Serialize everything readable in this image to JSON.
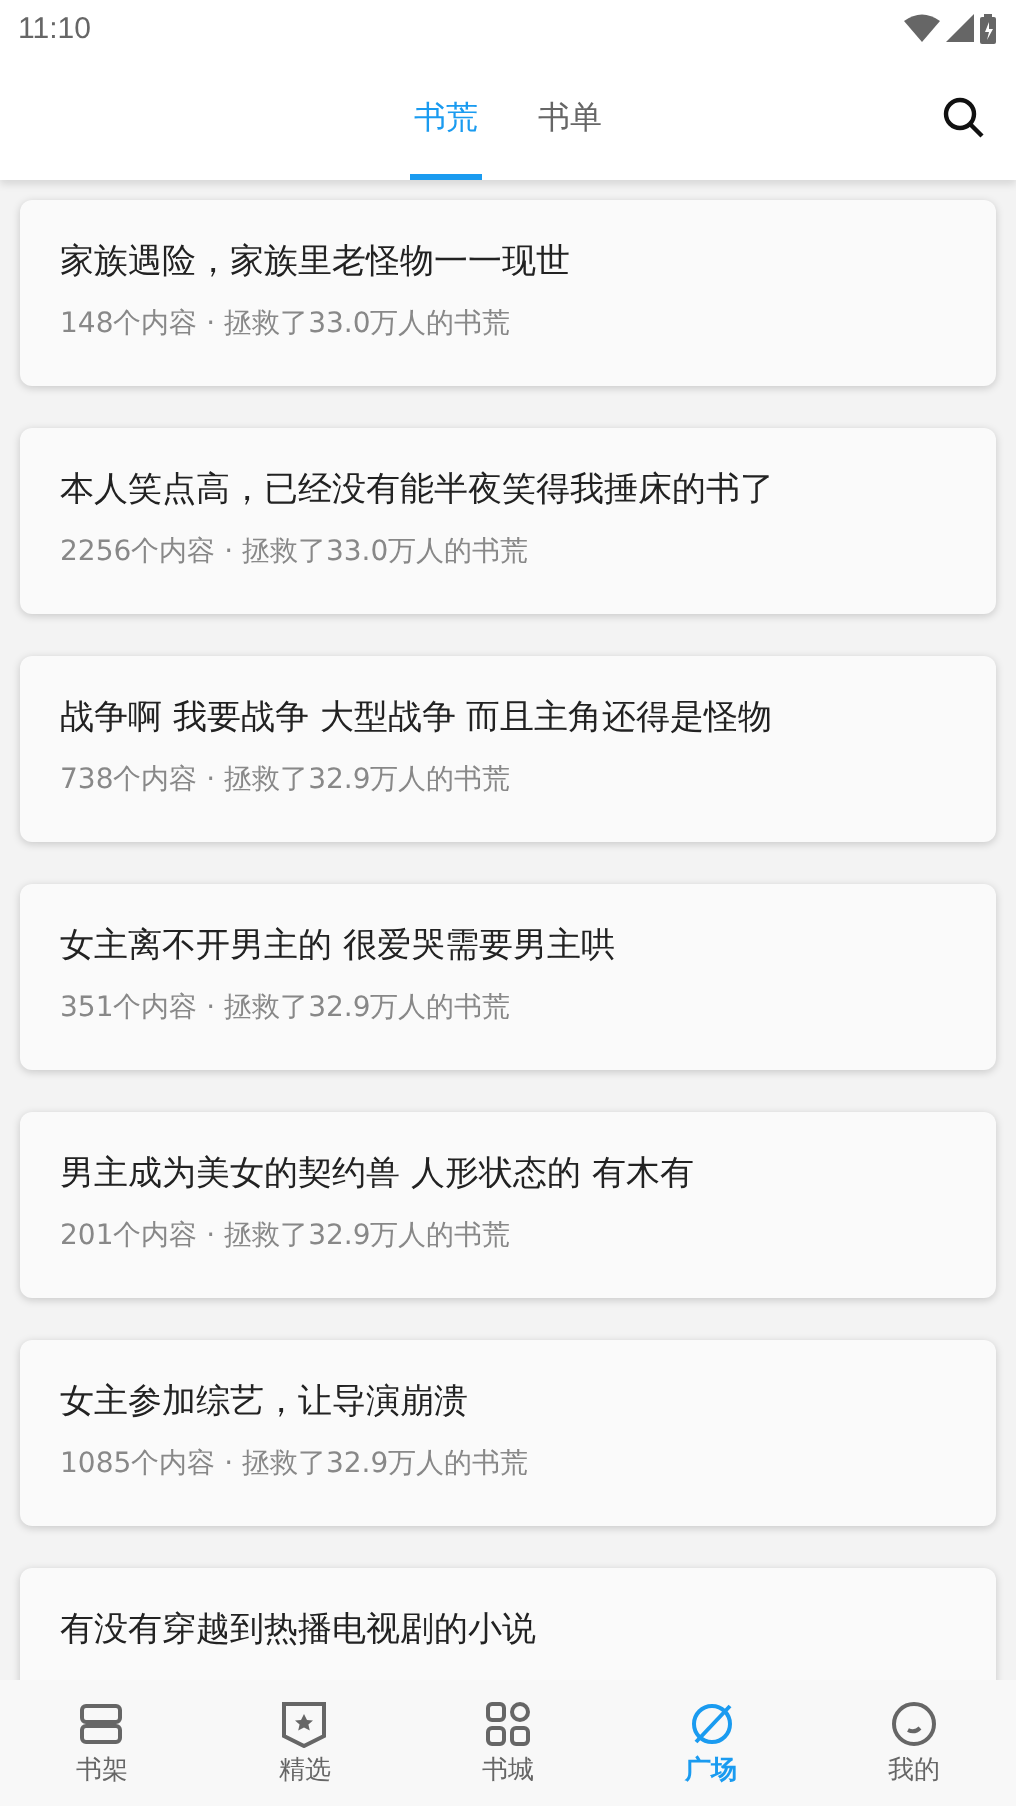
{
  "status_bar": {
    "time": "11:10"
  },
  "tabs": [
    {
      "label": "书荒",
      "selected": true
    },
    {
      "label": "书单",
      "selected": false
    }
  ],
  "cards": [
    {
      "title": "家族遇险，家族里老怪物一一现世",
      "meta": "148个内容 · 拯救了33.0万人的书荒"
    },
    {
      "title": "本人笑点高，已经没有能半夜笑得我捶床的书了",
      "meta": "2256个内容 · 拯救了33.0万人的书荒"
    },
    {
      "title": "战争啊 我要战争 大型战争 而且主角还得是怪物",
      "meta": "738个内容 · 拯救了32.9万人的书荒"
    },
    {
      "title": "女主离不开男主的 很爱哭需要男主哄",
      "meta": "351个内容 · 拯救了32.9万人的书荒"
    },
    {
      "title": "男主成为美女的契约兽 人形状态的 有木有",
      "meta": "201个内容 · 拯救了32.9万人的书荒"
    },
    {
      "title": "女主参加综艺，让导演崩溃",
      "meta": "1085个内容 · 拯救了32.9万人的书荒"
    },
    {
      "title": "有没有穿越到热播电视剧的小说"
    }
  ],
  "bottom_nav": [
    {
      "kind": "shelf",
      "label": "书架",
      "selected": false
    },
    {
      "kind": "featured",
      "label": "精选",
      "selected": false
    },
    {
      "kind": "store",
      "label": "书城",
      "selected": false
    },
    {
      "kind": "plaza",
      "label": "广场",
      "selected": true
    },
    {
      "kind": "me",
      "label": "我的",
      "selected": false
    }
  ]
}
